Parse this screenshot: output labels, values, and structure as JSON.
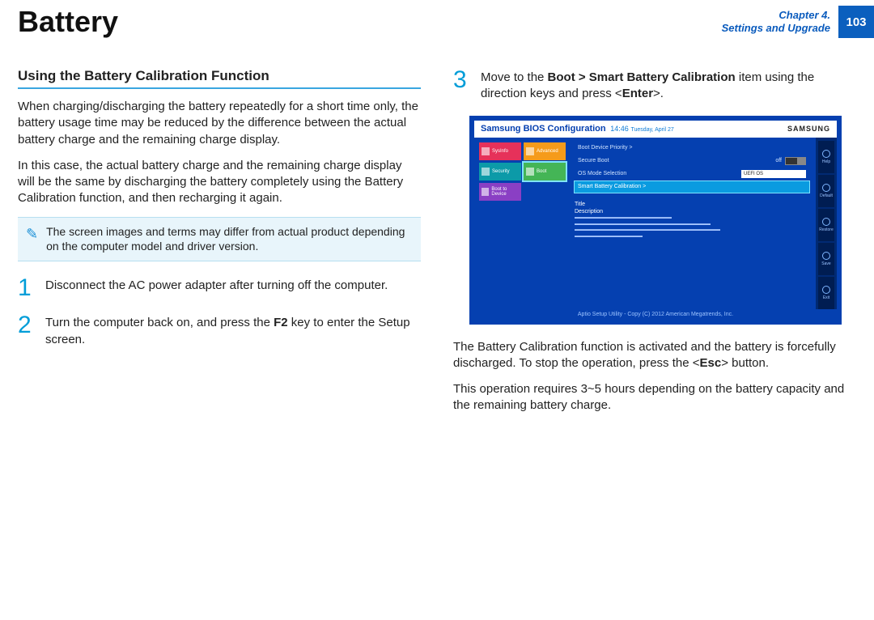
{
  "header": {
    "title": "Battery",
    "chapter_line1": "Chapter 4.",
    "chapter_line2": "Settings and Upgrade",
    "page_number": "103"
  },
  "left": {
    "section_heading": "Using the Battery Calibration Function",
    "para1": "When charging/discharging the battery repeatedly for a short time only, the battery usage time may be reduced by the difference between the actual battery charge and the remaining charge display.",
    "para2": "In this case, the actual battery charge and the remaining charge display will be the same by discharging the battery completely using the Battery Calibration function, and then recharging it again.",
    "note": "The screen images and terms may differ from actual product depending on the computer model and driver version.",
    "steps": [
      {
        "n": "1",
        "text": "Disconnect the AC power adapter after turning off the computer."
      },
      {
        "n": "2",
        "pre": "Turn the computer back on, and press the ",
        "bold": "F2",
        "post": " key to enter the Setup screen."
      }
    ]
  },
  "right": {
    "step3": {
      "n": "3",
      "pre": "Move to the ",
      "bold": "Boot > Smart Battery Calibration",
      "mid": " item using the direction keys and press <",
      "bold2": "Enter",
      "post": ">."
    },
    "para_after1_pre": "The Battery Calibration function is activated and the battery is forcefully discharged. To stop the operation, press the <",
    "para_after1_bold": "Esc",
    "para_after1_post": "> button.",
    "para_after2": "This operation requires 3~5 hours depending on the battery capacity and the remaining battery charge."
  },
  "bios": {
    "title": "Samsung BIOS Configuration",
    "time": "14:46",
    "date": "Tuesday, April 27",
    "logo": "SAMSUNG",
    "tiles": [
      {
        "cls": "t-red",
        "label": "SysInfo"
      },
      {
        "cls": "t-orange",
        "label": "Advanced"
      },
      {
        "cls": "t-teal",
        "label": "Security"
      },
      {
        "cls": "t-green t-active",
        "label": "Boot"
      },
      {
        "cls": "t-purple",
        "label": "Boot to Device"
      }
    ],
    "rows": {
      "r1": "Boot Device Priority >",
      "r2_label": "Secure Boot",
      "r2_val": "off",
      "r3_label": "OS Mode Selection",
      "r3_val": "UEFI OS",
      "r4": "Smart Battery Calibration >"
    },
    "desc_title": "Title",
    "desc_label": "Description",
    "rbtns": [
      "Help",
      "Default",
      "Restore",
      "Save",
      "Exit"
    ],
    "footer": "Aptio Setup Utility - Copy (C) 2012 American Megatrends, Inc."
  }
}
